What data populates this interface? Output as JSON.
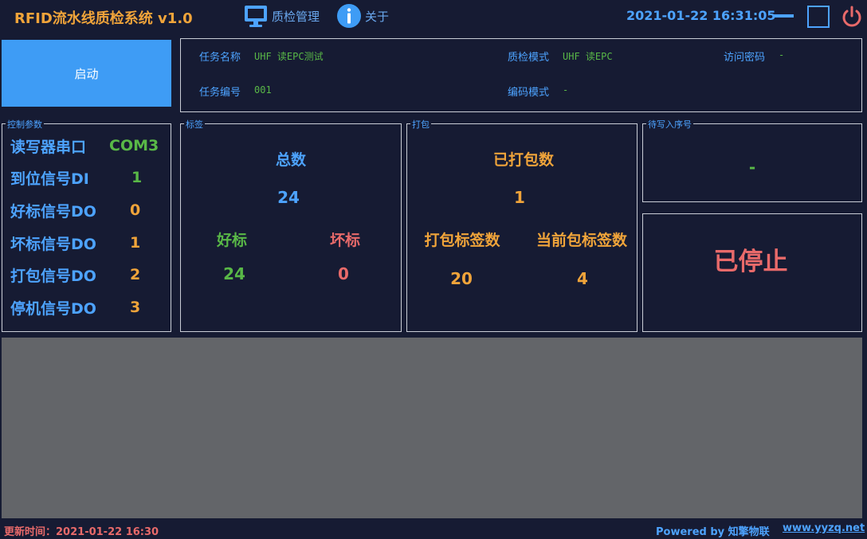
{
  "app": {
    "title": "RFID流水线质检系统 v1.0"
  },
  "nav": {
    "qc_manage": "质检管理",
    "about": "关于"
  },
  "clock": "2021-01-22 16:31:05",
  "window_controls": [
    "minimize-icon",
    "maximize-icon",
    "power-icon"
  ],
  "start_button": "启动",
  "task": {
    "name_label": "任务名称",
    "name_value": "UHF 读EPC测试",
    "id_label": "任务编号",
    "id_value": "001",
    "qc_mode_label": "质检模式",
    "qc_mode_value": "UHF 读EPC",
    "encode_mode_label": "编码模式",
    "encode_mode_value": "-",
    "access_pwd_label": "访问密码",
    "access_pwd_value": "-"
  },
  "control_params": {
    "legend": "控制参数",
    "items": [
      {
        "label": "读写器串口",
        "value": "COM3",
        "color": "#59b847"
      },
      {
        "label": "到位信号DI",
        "value": "1",
        "color": "#59b847"
      },
      {
        "label": "好标信号DO",
        "value": "0",
        "color": "#f0a43a"
      },
      {
        "label": "坏标信号DO",
        "value": "1",
        "color": "#f0a43a"
      },
      {
        "label": "打包信号DO",
        "value": "2",
        "color": "#f0a43a"
      },
      {
        "label": "停机信号DO",
        "value": "3",
        "color": "#f0a43a"
      }
    ]
  },
  "tags": {
    "legend": "标签",
    "total_label": "总数",
    "total_value": "24",
    "good_label": "好标",
    "good_value": "24",
    "bad_label": "坏标",
    "bad_value": "0"
  },
  "pack": {
    "legend": "打包",
    "packed_label": "已打包数",
    "packed_value": "1",
    "tags_per_pack_label": "打包标签数",
    "tags_per_pack_value": "20",
    "current_pack_label": "当前包标签数",
    "current_pack_value": "4"
  },
  "pending": {
    "legend": "待写入序号",
    "value": "-"
  },
  "status": {
    "text": "已停止",
    "color": "#e86a6a"
  },
  "footer": {
    "update_label": "更新时间：",
    "update_value": "2021-01-22 16:30",
    "powered": "Powered by 知擎物联",
    "site": "www.yyzq.net"
  },
  "colors": {
    "accent": "#4da3ff",
    "title": "#f0a43a",
    "good": "#59b847",
    "bad": "#e86a6a",
    "background": "#161b33"
  }
}
